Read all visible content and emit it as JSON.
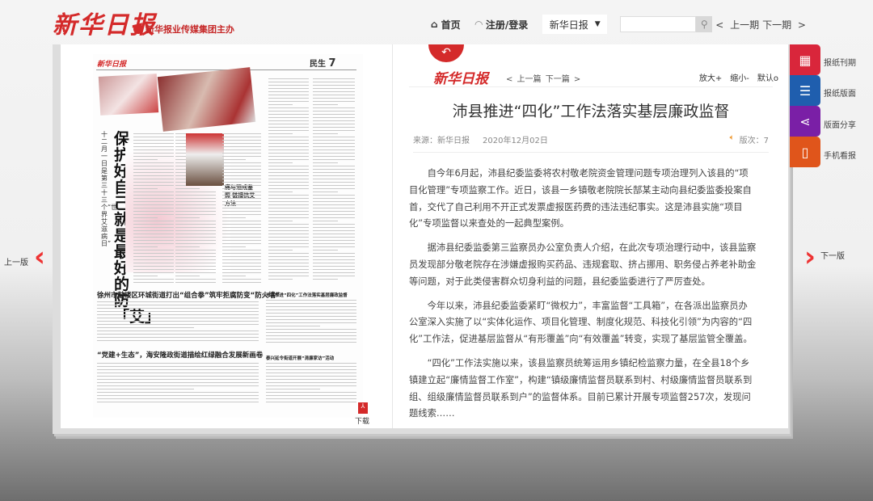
{
  "header": {
    "logo": "新华日报",
    "sublogo": "新华报业传媒集团主办",
    "home": "首页",
    "login": "注册/登录",
    "paper_select": "新华日报",
    "search_placeholder": "",
    "prev_issue": "< 上一期",
    "next_issue": "下一期 >"
  },
  "page_image": {
    "masthead": "新华日报",
    "section": "民生",
    "page_no": "7",
    "headline": "保护好自己，就是最好的防「艾」",
    "subhead": "十二月一日是第三十三个“世界艾滋病日”",
    "inset_title": "痛与泪成鉴照 链接抗艾方法",
    "story2": "徐州市鼓楼区环城街道打出“组合拳”筑牢拒腐防变“防火墙”",
    "story3": "“党建+生态”，海安隆政街道描绘红绿融合发展新画卷",
    "story4": "沛县推进“四化”工作法落实基层廉政监督",
    "story5": "泰兴延令街道开展“清廉家访”活动",
    "download": "下载"
  },
  "article": {
    "logo": "新华日报",
    "prev": "< 上一篇",
    "next": "下一篇 >",
    "zoom_in": "放大+",
    "zoom_out": "缩小-",
    "reset": "默认o",
    "title": "沛县推进“四化”工作法落实基层廉政监督",
    "source": "来源：新华日报",
    "date": "2020年12月02日",
    "edition": "版次：7",
    "paragraphs": [
      "自今年6月起，沛县纪委监委将农村敬老院资金管理问题专项治理列入该县的“项目化管理”专项监察工作。近日，该县一乡镇敬老院院长郜某主动向县纪委监委投案自首，交代了自己利用不开正式发票虚报医药费的违法违纪事实。这是沛县实施“项目化”专项监督以来查处的一起典型案例。",
      "据沛县纪委监委第三监察员办公室负责人介绍，在此次专项治理行动中，该县监察员发现部分敬老院存在涉嫌虚报购买药品、违规套取、挤占挪用、职务侵占养老补助金等问题，对于此类侵害群众切身利益的问题，县纪委监委进行了严厉查处。",
      "今年以来，沛县纪委监委紧盯“微权力”，丰富监督“工具箱”，在各派出监察员办公室深入实施了以“实体化运作、项目化管理、制度化规范、科技化引领”为内容的“四化”工作法，促进基层监督从“有形覆盖”向“有效覆盖”转变，实现了基层监管全覆盖。",
      "“四化”工作法实施以来，该县监察员统筹运用乡镇纪检监察力量，在全县18个乡镇建立起“廉情监督工作室”，构建“镇级廉情监督员联系到村、村级廉情监督员联系到组、组级廉情监督员联系到户”的监督体系。目前已累计开展专项监督257次，发现问题线索……"
    ]
  },
  "sidebar": [
    {
      "label": "报纸刊期",
      "icon": "calendar-icon",
      "color": "#d9263b"
    },
    {
      "label": "报纸版面",
      "icon": "list-icon",
      "color": "#1f5eae"
    },
    {
      "label": "版面分享",
      "icon": "share-icon",
      "color": "#7a1fa6"
    },
    {
      "label": "手机看报",
      "icon": "phone-icon",
      "color": "#e0551b"
    }
  ],
  "pager": {
    "prev": "上一版",
    "next": "下一版"
  }
}
